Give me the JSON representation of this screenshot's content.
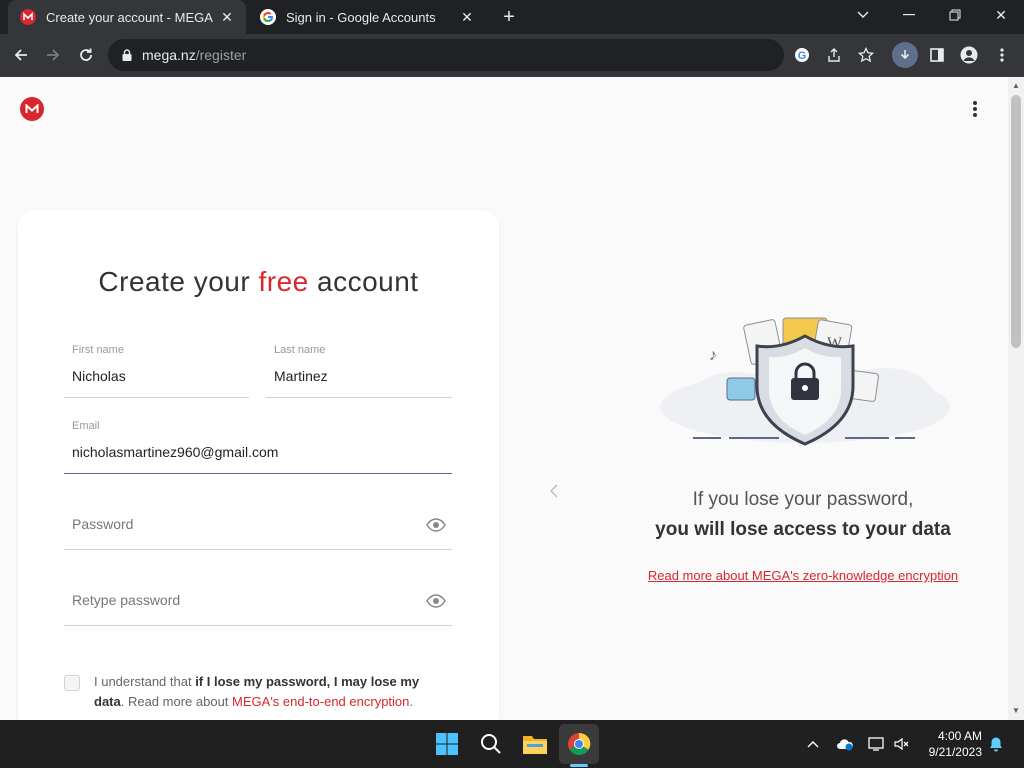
{
  "browser": {
    "tabs": [
      {
        "title": "Create your account - MEGA",
        "active": true,
        "favicon": "mega-icon"
      },
      {
        "title": "Sign in - Google Accounts",
        "active": false,
        "favicon": "google-icon"
      }
    ],
    "url_host": "mega.nz",
    "url_path": "/register"
  },
  "page": {
    "heading_pre": "Create your",
    "heading_free": "free",
    "heading_post": "account",
    "form": {
      "first_name_label": "First name",
      "first_name_value": "Nicholas",
      "last_name_label": "Last name",
      "last_name_value": "Martinez",
      "email_label": "Email",
      "email_value": "nicholasmartinez960@gmail.com",
      "password_placeholder": "Password",
      "retype_placeholder": "Retype password"
    },
    "consent": {
      "part1": "I understand that ",
      "bold": "if I lose my password, I may lose my data",
      "part2": ". Read more about ",
      "link": "MEGA's end-to-end encryption",
      "part3": "."
    },
    "info": {
      "line1": "If you lose your password,",
      "line2": "you will lose access to your data",
      "link": "Read more about MEGA's zero-knowledge encryption"
    }
  },
  "taskbar": {
    "time": "4:00 AM",
    "date": "9/21/2023"
  },
  "colors": {
    "brand_red": "#d9272e",
    "chrome_dark": "#202124",
    "chrome_toolbar": "#35363a",
    "taskbar": "#202020"
  }
}
